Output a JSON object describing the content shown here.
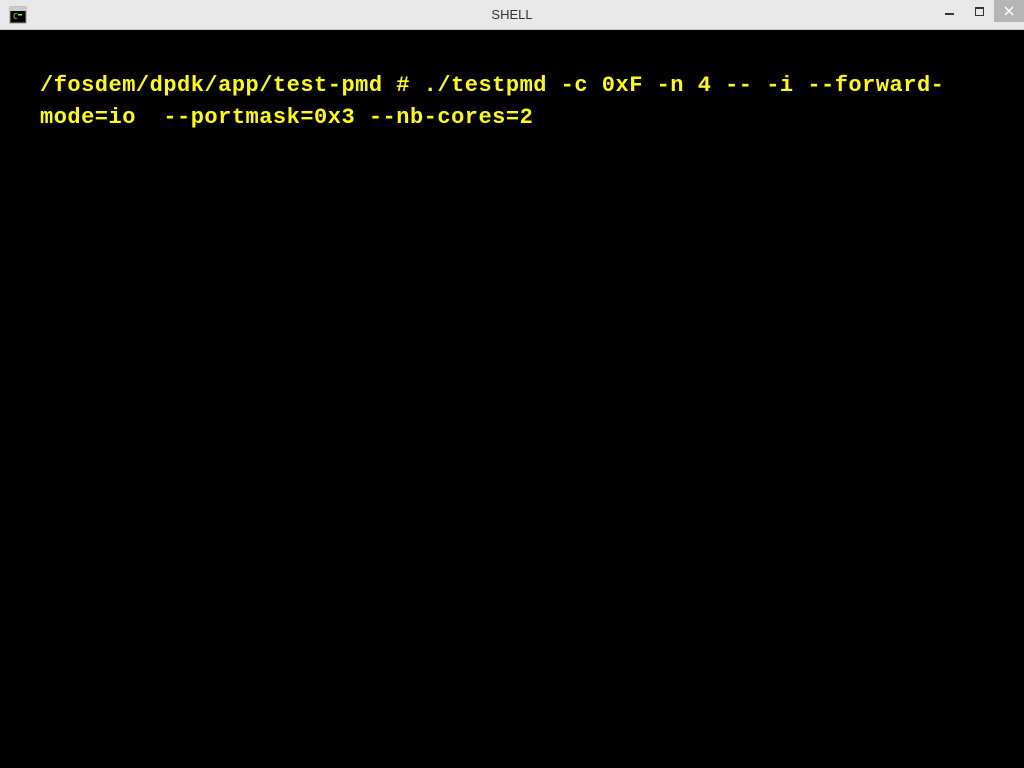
{
  "window": {
    "title": "SHELL",
    "icon_name": "terminal-app-icon"
  },
  "controls": {
    "minimize": "minimize",
    "maximize": "maximize",
    "close": "close"
  },
  "terminal": {
    "content": "/fosdem/dpdk/app/test-pmd # ./testpmd -c 0xF -n 4 -- -i --forward-mode=io  --portmask=0x3 --nb-cores=2",
    "prompt_path": "/fosdem/dpdk/app/test-pmd",
    "command": "./testpmd -c 0xF -n 4 -- -i --forward-mode=io  --portmask=0x3 --nb-cores=2",
    "text_color": "#ffff00",
    "background_color": "#000000"
  }
}
